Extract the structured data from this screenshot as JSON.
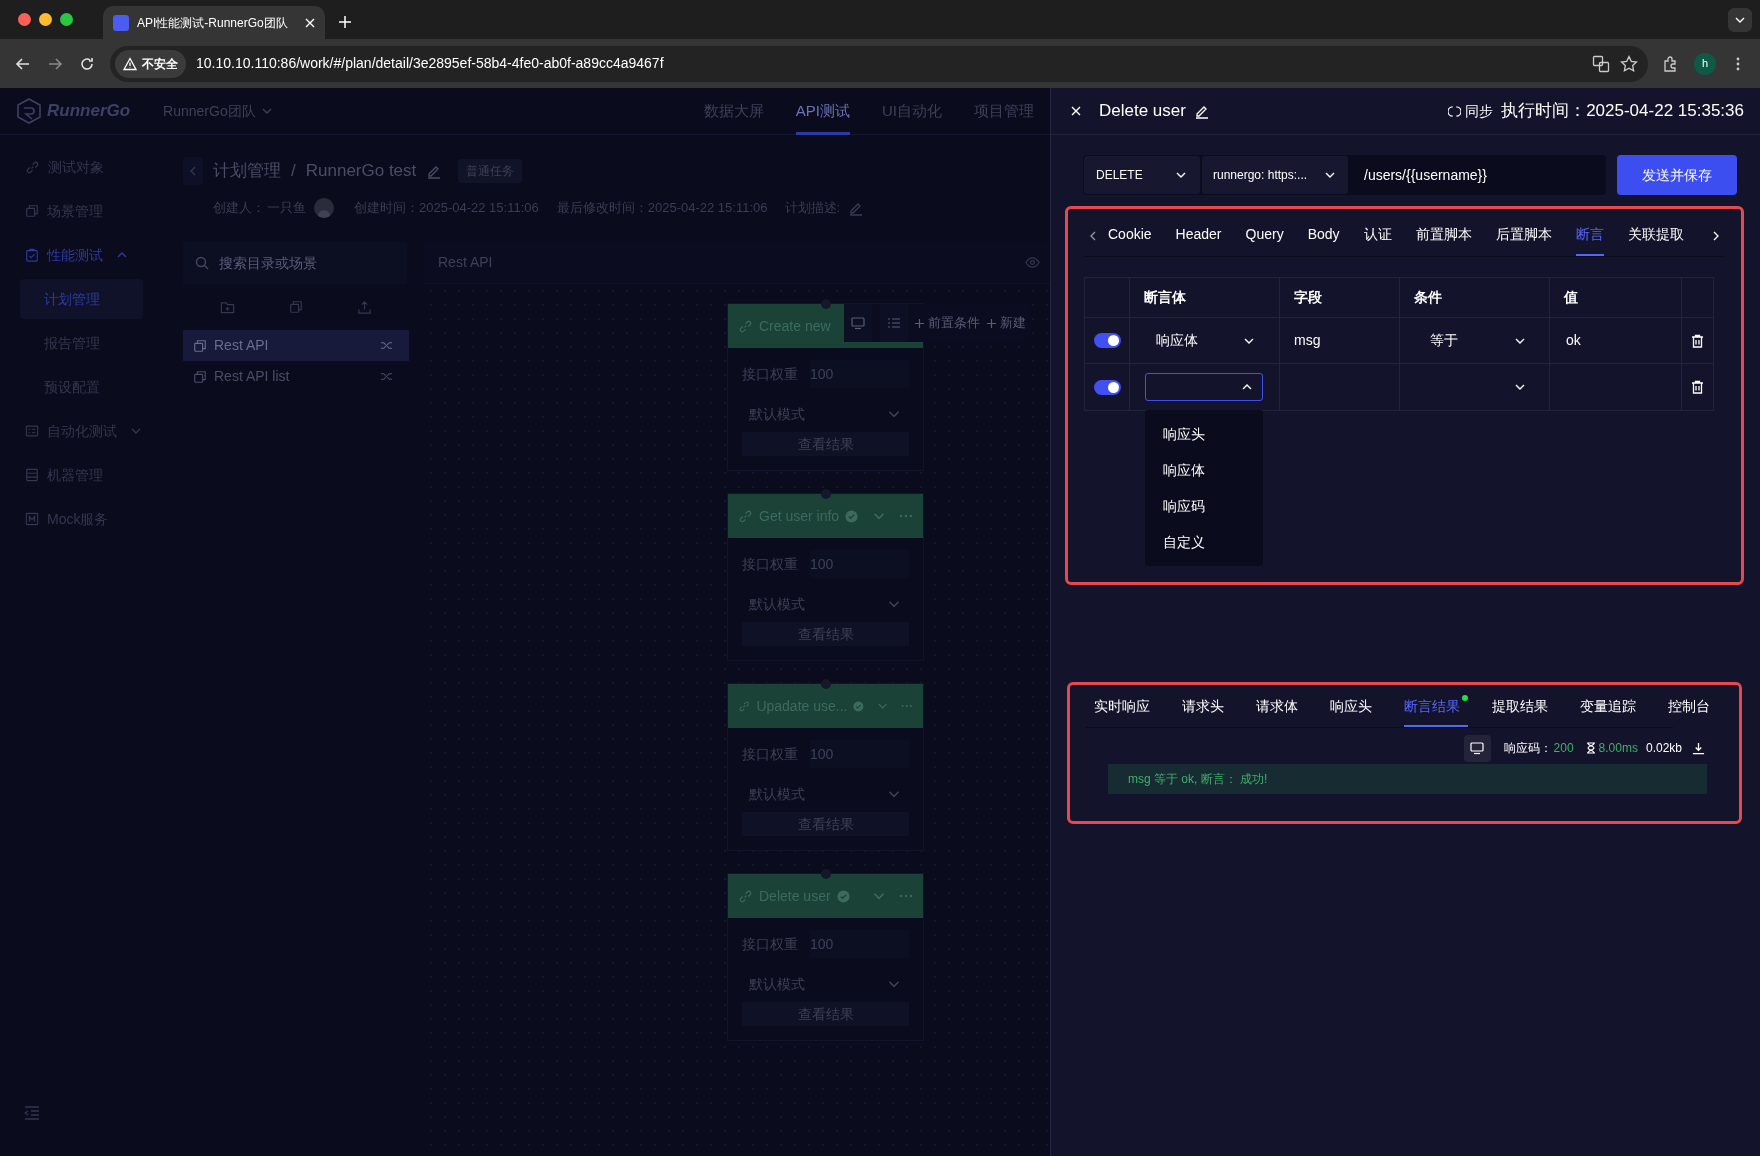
{
  "browser": {
    "tab_title": "API性能测试-RunnerGo团队",
    "security_label": "不安全",
    "url": "10.10.10.110:86/work/#/plan/detail/3e2895ef-58b4-4fe0-ab0f-a89cc4a9467f",
    "profile_initial": "h"
  },
  "app": {
    "logo": "RunnerGo",
    "team": "RunnerGo团队",
    "nav": [
      {
        "label": "数据大屏",
        "selected": false
      },
      {
        "label": "API测试",
        "selected": true
      },
      {
        "label": "UI自动化",
        "selected": false
      },
      {
        "label": "项目管理",
        "selected": false
      }
    ]
  },
  "sidebar": {
    "items": [
      {
        "kind": "link",
        "label": "测试对象",
        "selected": false
      },
      {
        "kind": "link",
        "label": "场景管理",
        "selected": false
      },
      {
        "kind": "group",
        "label": "性能测试",
        "selected": true,
        "expanded": true,
        "children": [
          {
            "label": "计划管理",
            "selected": true
          },
          {
            "label": "报告管理",
            "selected": false
          },
          {
            "label": "预设配置",
            "selected": false
          }
        ]
      },
      {
        "kind": "group",
        "label": "自动化测试",
        "selected": false,
        "expanded": false
      },
      {
        "kind": "link",
        "label": "机器管理",
        "selected": false
      },
      {
        "kind": "link",
        "label": "Mock服务",
        "selected": false
      }
    ]
  },
  "breadcrumb": {
    "parent": "计划管理",
    "separator": "/",
    "current": "RunnerGo test",
    "tag": "普通任务"
  },
  "meta": {
    "creator_label": "创建人：",
    "creator": "一只鱼",
    "created": "创建时间：2025-04-22 15:11:06",
    "modified": "最后修改时间：2025-04-22 15:11:06",
    "description_label": "计划描述:"
  },
  "tree": {
    "placeholder": "搜索目录或场景",
    "items": [
      {
        "label": "Rest API",
        "selected": true
      },
      {
        "label": "Rest API list",
        "selected": false
      }
    ]
  },
  "canvas": {
    "title": "Rest API",
    "toolbar_actions": [
      "前置条件",
      "新建"
    ],
    "nodes": [
      {
        "title": "Create new",
        "weight_label": "接口权重",
        "weight": "100",
        "mode": "默认模式",
        "result_button": "查看结果"
      },
      {
        "title": "Get user info",
        "passed": true,
        "weight_label": "接口权重",
        "weight": "100",
        "mode": "默认模式",
        "result_button": "查看结果"
      },
      {
        "title": "Upadate use...",
        "passed": true,
        "weight_label": "接口权重",
        "weight": "100",
        "mode": "默认模式",
        "result_button": "查看结果"
      },
      {
        "title": "Delete user",
        "passed": true,
        "weight_label": "接口权重",
        "weight": "100",
        "mode": "默认模式",
        "result_button": "查看结果"
      }
    ]
  },
  "drawer": {
    "title": "Delete user",
    "sync": "同步",
    "exec_time": "执行时间：2025-04-22 15:35:36",
    "method": "DELETE",
    "environment": "runnergo: https:...",
    "path": "/users/{{username}}",
    "send_button": "发送并保存"
  },
  "request_tabs": [
    {
      "label": "Cookie",
      "selected": false
    },
    {
      "label": "Header",
      "selected": false
    },
    {
      "label": "Query",
      "selected": false
    },
    {
      "label": "Body",
      "selected": false
    },
    {
      "label": "认证",
      "selected": false
    },
    {
      "label": "前置脚本",
      "selected": false
    },
    {
      "label": "后置脚本",
      "selected": false
    },
    {
      "label": "断言",
      "selected": true
    },
    {
      "label": "关联提取",
      "selected": false
    }
  ],
  "assert_table": {
    "columns": [
      "断言体",
      "字段",
      "条件",
      "值"
    ],
    "rows": [
      {
        "enabled": true,
        "open": false,
        "source": "响应体",
        "field": "msg",
        "condition": "等于",
        "value": "ok"
      },
      {
        "enabled": true,
        "open": true
      }
    ],
    "dropdown_options": [
      "响应头",
      "响应体",
      "响应码",
      "自定义"
    ]
  },
  "response_tabs": [
    {
      "label": "实时响应",
      "selected": false,
      "dot": false
    },
    {
      "label": "请求头",
      "selected": false,
      "dot": false
    },
    {
      "label": "请求体",
      "selected": false,
      "dot": false
    },
    {
      "label": "响应头",
      "selected": false,
      "dot": false
    },
    {
      "label": "断言结果",
      "selected": true,
      "dot": true
    },
    {
      "label": "提取结果",
      "selected": false,
      "dot": false
    },
    {
      "label": "变量追踪",
      "selected": false,
      "dot": false
    },
    {
      "label": "控制台",
      "selected": false,
      "dot": false
    }
  ],
  "response": {
    "code_label": "响应码：",
    "code": "200",
    "time": "8.00ms",
    "size": "0.02kb",
    "assertion_message": "msg 等于 ok, 断言： 成功!"
  }
}
